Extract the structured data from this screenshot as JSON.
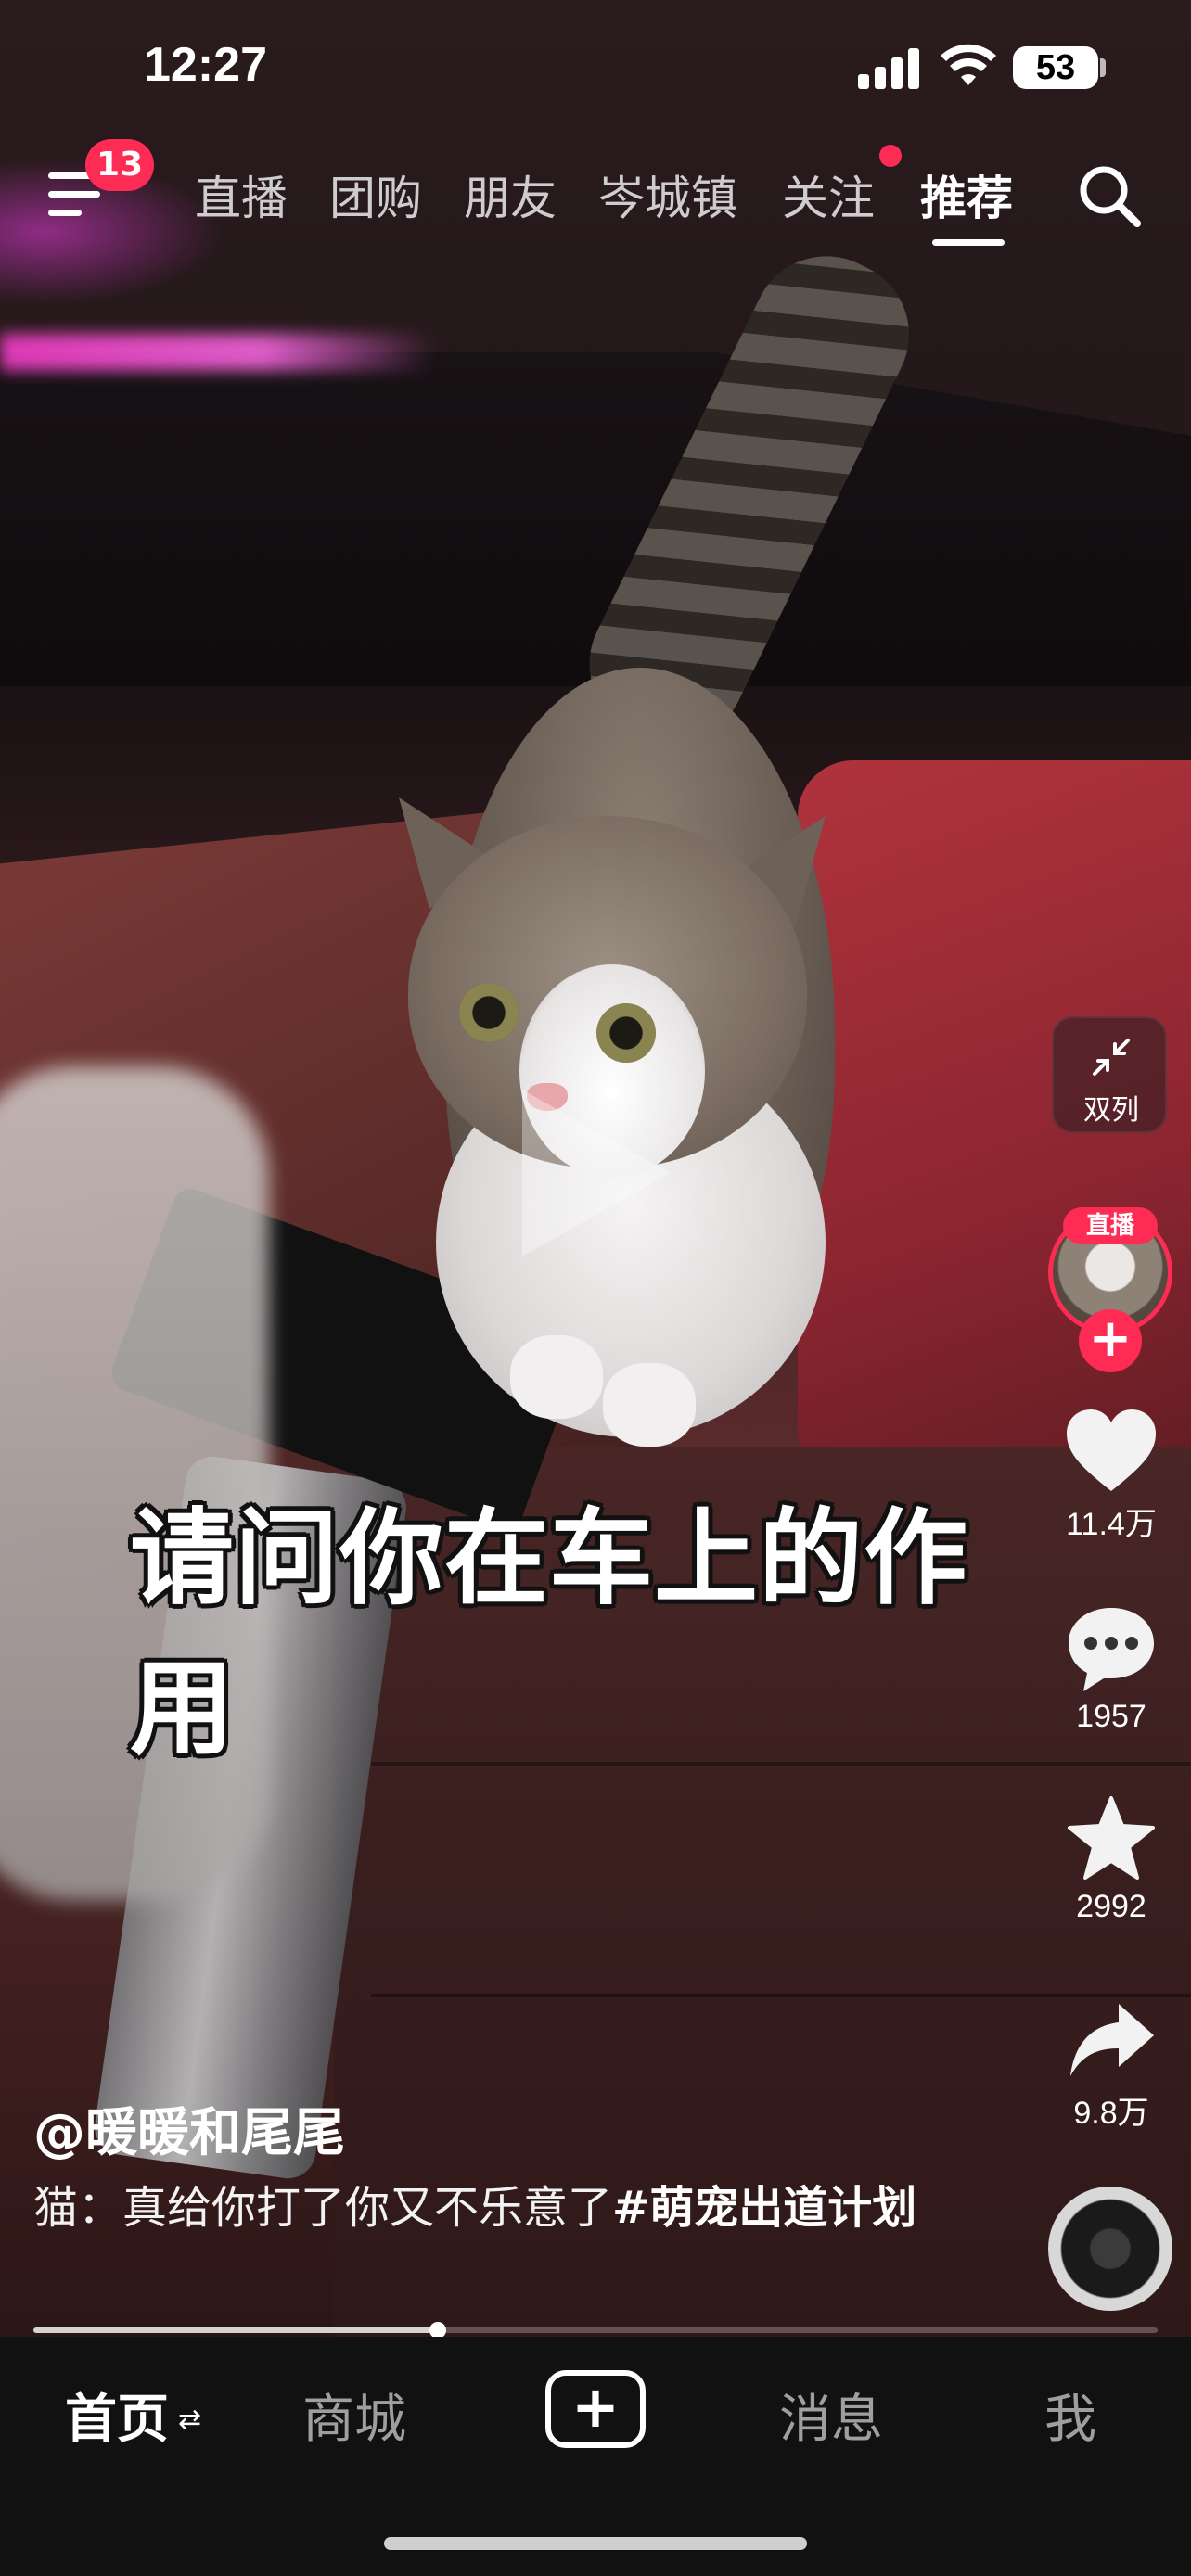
{
  "status_bar": {
    "time": "12:27",
    "battery": "53"
  },
  "top_nav": {
    "menu_badge": "13",
    "tabs": [
      {
        "label": "直播",
        "active": false
      },
      {
        "label": "团购",
        "active": false
      },
      {
        "label": "朋友",
        "active": false
      },
      {
        "label": "岑城镇",
        "active": false
      },
      {
        "label": "关注",
        "active": false
      },
      {
        "label": "推荐",
        "active": true
      }
    ]
  },
  "video": {
    "subtitle": "请问你在车上的作用",
    "progress_fraction": 0.36
  },
  "right_rail": {
    "dual_column_label": "双列",
    "live_tag": "直播",
    "follow_symbol": "+",
    "likes": "11.4万",
    "comments": "1957",
    "favorites": "2992",
    "shares": "9.8万"
  },
  "caption": {
    "author": "@暖暖和尾尾",
    "text": "猫：真给你打了你又不乐意了",
    "hashtag": "#萌宠出道计划"
  },
  "bottom_nav": {
    "home": "首页",
    "mall": "商城",
    "create": "+",
    "messages": "消息",
    "me": "我"
  },
  "colors": {
    "accent": "#fe2c55",
    "nav_bg": "#111111"
  },
  "icons": [
    "menu-icon",
    "search-icon",
    "collapse-arrows-icon",
    "heart-icon",
    "comment-icon",
    "star-icon",
    "share-icon",
    "refresh-icon",
    "plus-icon",
    "play-icon"
  ]
}
